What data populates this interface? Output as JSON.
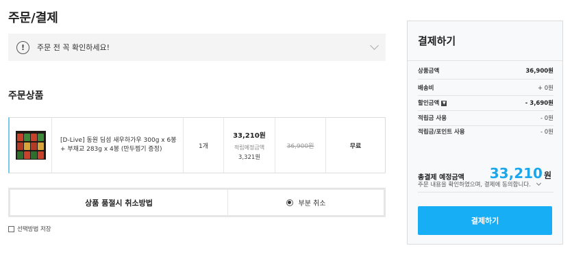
{
  "page": {
    "title": "주문/결제"
  },
  "notice": {
    "icon": "exclamation-circle-icon",
    "text": "주문 전 꼭 확인하세요!"
  },
  "order_items": {
    "title": "주문상품",
    "item": {
      "name": "[D-Live] 동원 딤섬 새우하가우 300g x 6봉 + 부채교 283g x 4봉 (만두찜기 증정)",
      "quantity": "1개",
      "price": "33,210원",
      "points_label": "적립예정금액",
      "points_value": "3,321원",
      "original_price": "36,900원",
      "shipping": "무료"
    }
  },
  "cancel_method": {
    "label": "상품 품절시 취소방법",
    "option": "부분 취소"
  },
  "save_method": {
    "label": "선택방법 저장"
  },
  "payment": {
    "title": "결제하기",
    "rows": [
      {
        "label": "상품금액",
        "value": "36,900원"
      },
      {
        "label": "배송비",
        "value": "+ 0원"
      },
      {
        "label": "할인금액",
        "value": "- 3,690원"
      },
      {
        "label": "적립금 사용",
        "value": "- 0원"
      },
      {
        "label": "적립금/포인트 사용",
        "value": "- 0원"
      }
    ],
    "total_label": "총결제 예정금액",
    "total_amount": "33,210",
    "total_unit": "원",
    "agree_text": "주문 내용을 확인하였으며, 결제에 동의합니다.",
    "button_label": "결제하기",
    "accent_color": "#18aef6"
  }
}
